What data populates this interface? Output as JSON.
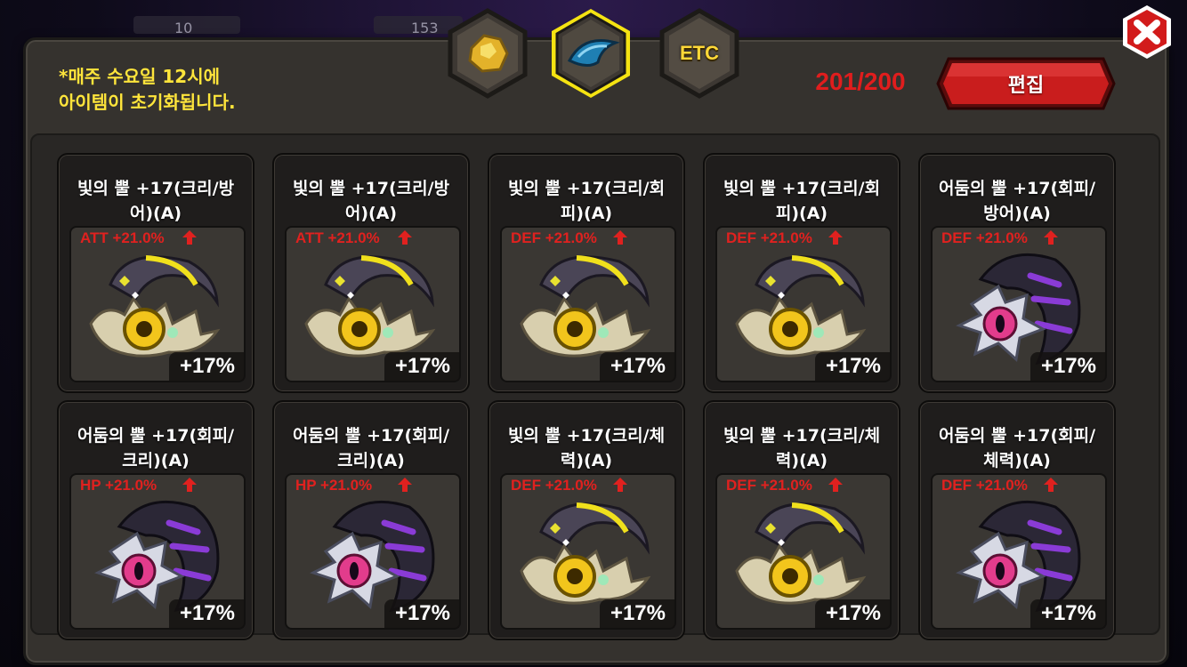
{
  "background_hud": {
    "left_value": "10",
    "mid_value": "153"
  },
  "notice": {
    "line1": "*매주 수요일 12시에",
    "line2": "아이템이 초기화됩니다."
  },
  "tabs": [
    {
      "icon": "gold-ore-icon",
      "selected": false
    },
    {
      "icon": "blue-horn-icon",
      "selected": true
    },
    {
      "label": "ETC",
      "selected": false
    }
  ],
  "inventory_count": "201/200",
  "edit_button": "편집",
  "close_icon": "close-icon",
  "colors": {
    "stat_red": "#e0211f",
    "notice_yellow": "#ffe53b",
    "selected_glow": "#f5e312"
  },
  "items": [
    {
      "name": "빛의 뿔 +17(크리/방\n어)(A)",
      "stat": "ATT +21.0%",
      "percent": "+17%",
      "type": "light"
    },
    {
      "name": "빛의 뿔 +17(크리/방\n어)(A)",
      "stat": "ATT +21.0%",
      "percent": "+17%",
      "type": "light"
    },
    {
      "name": "빛의 뿔 +17(크리/회\n피)(A)",
      "stat": "DEF +21.0%",
      "percent": "+17%",
      "type": "light"
    },
    {
      "name": "빛의 뿔 +17(크리/회\n피)(A)",
      "stat": "DEF +21.0%",
      "percent": "+17%",
      "type": "light"
    },
    {
      "name": "어둠의 뿔 +17(회피/\n방어)(A)",
      "stat": "DEF +21.0%",
      "percent": "+17%",
      "type": "dark"
    },
    {
      "name": "어둠의 뿔 +17(회피/\n크리)(A)",
      "stat": "HP +21.0%",
      "percent": "+17%",
      "type": "dark"
    },
    {
      "name": "어둠의 뿔 +17(회피/\n크리)(A)",
      "stat": "HP +21.0%",
      "percent": "+17%",
      "type": "dark"
    },
    {
      "name": "빛의 뿔 +17(크리/체\n력)(A)",
      "stat": "DEF +21.0%",
      "percent": "+17%",
      "type": "light"
    },
    {
      "name": "빛의 뿔 +17(크리/체\n력)(A)",
      "stat": "DEF +21.0%",
      "percent": "+17%",
      "type": "light"
    },
    {
      "name": "어둠의 뿔 +17(회피/\n체력)(A)",
      "stat": "DEF +21.0%",
      "percent": "+17%",
      "type": "dark"
    }
  ]
}
